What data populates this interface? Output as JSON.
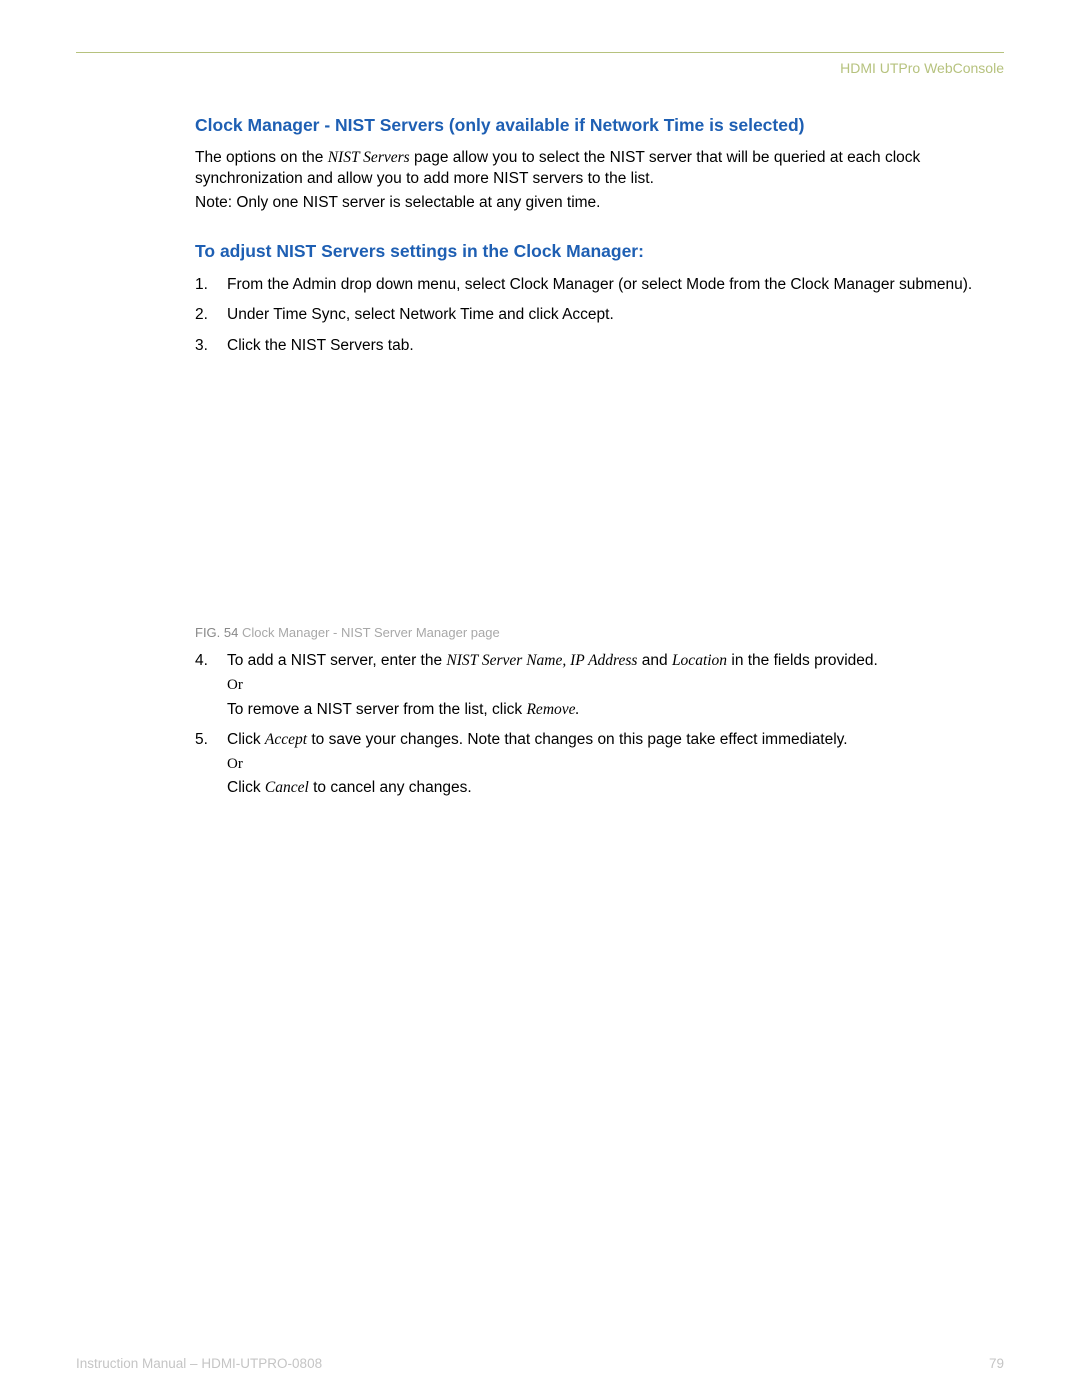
{
  "header": {
    "title": "HDMI UTPro WebConsole"
  },
  "section1": {
    "heading": "Clock Manager - NIST Servers (only available if Network Time is selected)",
    "para1_a": "The options on the ",
    "para1_b": "NIST Servers",
    "para1_c": " page allow you to select the NIST server that will be queried at each clock synchronization and allow you to add more NIST servers to the list.",
    "para2": "Note:  Only one NIST server is selectable at any given time."
  },
  "section2": {
    "heading": "To adjust NIST Servers settings in the Clock Manager:",
    "steps123": [
      {
        "n": "1.",
        "t": "From the Admin drop down menu, select Clock Manager (or select Mode from the Clock Manager submenu)."
      },
      {
        "n": "2.",
        "t": "Under Time Sync, select Network Time and click Accept."
      },
      {
        "n": "3.",
        "t": "Click the NIST Servers tab."
      }
    ]
  },
  "figure": {
    "label_a": "FIG. 54",
    "label_b": " Clock Manager - NIST Server Manager page"
  },
  "section3": {
    "step4": {
      "n": "4.",
      "a": "To add a NIST server, enter the ",
      "b": "NIST Server Name, IP Address",
      "c": " and ",
      "d": "Location",
      "e": " in the fields provided.",
      "or": "Or",
      "f": "To remove a NIST server from the list, click ",
      "g": "Remove."
    },
    "step5": {
      "n": "5.",
      "a": "Click ",
      "b": "Accept",
      "c": " to save your changes. Note that changes on this page take effect immediately.",
      "or": "Or",
      "d": "Click ",
      "e": "Cancel",
      "f": " to cancel any changes."
    }
  },
  "footer": {
    "left": "Instruction Manual – HDMI-UTPRO-0808",
    "right": "79"
  }
}
